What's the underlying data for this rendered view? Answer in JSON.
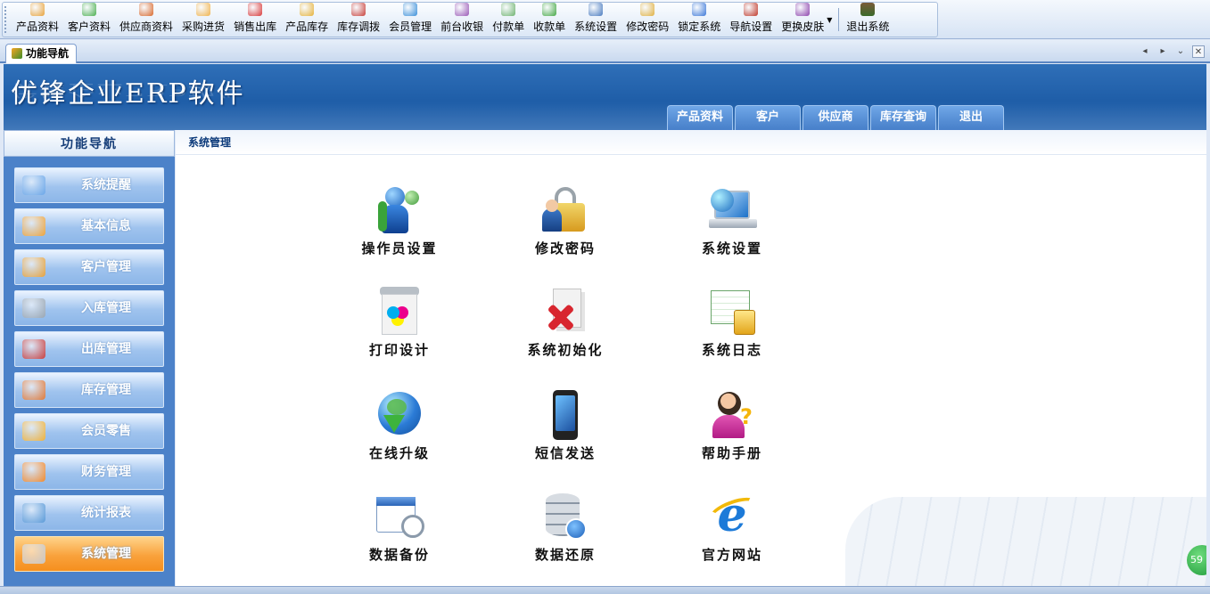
{
  "toolbar": {
    "items": [
      {
        "label": "产品资料",
        "color": "#e8a23a"
      },
      {
        "label": "客户资料",
        "color": "#4caf50"
      },
      {
        "label": "供应商资料",
        "color": "#d9692d"
      },
      {
        "label": "采购进货",
        "color": "#f1b34b"
      },
      {
        "label": "销售出库",
        "color": "#d93a3a"
      },
      {
        "label": "产品库存",
        "color": "#e6b23a"
      },
      {
        "label": "库存调拨",
        "color": "#c8403a"
      },
      {
        "label": "会员管理",
        "color": "#3a8fd9"
      },
      {
        "label": "前台收银",
        "color": "#9b59b6"
      },
      {
        "label": "付款单",
        "color": "#6fb36f"
      },
      {
        "label": "收款单",
        "color": "#45a845"
      },
      {
        "label": "系统设置",
        "color": "#4a7bbf"
      },
      {
        "label": "修改密码",
        "color": "#e0b040"
      },
      {
        "label": "锁定系统",
        "color": "#3c78d8"
      },
      {
        "label": "导航设置",
        "color": "#c0392b"
      },
      {
        "label": "更换皮肤",
        "color": "#8e44ad"
      }
    ],
    "exit_label": "退出系统"
  },
  "tabs": {
    "active_tab": "功能导航"
  },
  "banner": {
    "app_title": "优锋企业ERP软件",
    "top_nav": [
      "产品资料",
      "客户",
      "供应商",
      "库存查询",
      "退出"
    ]
  },
  "left_panel": {
    "header": "功能导航",
    "items": [
      {
        "label": "系统提醒",
        "icon": "reminder-icon",
        "color": "#6aa6e8"
      },
      {
        "label": "基本信息",
        "icon": "info-icon",
        "color": "#f0a43a"
      },
      {
        "label": "客户管理",
        "icon": "customers-icon",
        "color": "#e8a23a"
      },
      {
        "label": "入库管理",
        "icon": "cart-in-icon",
        "color": "#9aa6b2"
      },
      {
        "label": "出库管理",
        "icon": "cart-out-icon",
        "color": "#c94040"
      },
      {
        "label": "库存管理",
        "icon": "warehouse-icon",
        "color": "#e07a3a"
      },
      {
        "label": "会员零售",
        "icon": "member-icon",
        "color": "#f0b23a"
      },
      {
        "label": "财务管理",
        "icon": "finance-icon",
        "color": "#f28a2e"
      },
      {
        "label": "统计报表",
        "icon": "report-icon",
        "color": "#5a9ad8"
      },
      {
        "label": "系统管理",
        "icon": "gears-icon",
        "color": "#c7c7c7"
      }
    ],
    "active_index": 9
  },
  "content": {
    "title": "系统管理",
    "functions": [
      {
        "label": "操作员设置",
        "icon": "operator-icon"
      },
      {
        "label": "修改密码",
        "icon": "lock-icon"
      },
      {
        "label": "系统设置",
        "icon": "laptop-globe-icon"
      },
      {
        "label": "打印设计",
        "icon": "printer-icon"
      },
      {
        "label": "系统初始化",
        "icon": "init-icon"
      },
      {
        "label": "系统日志",
        "icon": "log-icon"
      },
      {
        "label": "在线升级",
        "icon": "globe-download-icon"
      },
      {
        "label": "短信发送",
        "icon": "phone-icon"
      },
      {
        "label": "帮助手册",
        "icon": "help-icon"
      },
      {
        "label": "数据备份",
        "icon": "calendar-clock-icon"
      },
      {
        "label": "数据还原",
        "icon": "database-restore-icon"
      },
      {
        "label": "官方网站",
        "icon": "ie-icon"
      }
    ],
    "badge_text": "59"
  }
}
